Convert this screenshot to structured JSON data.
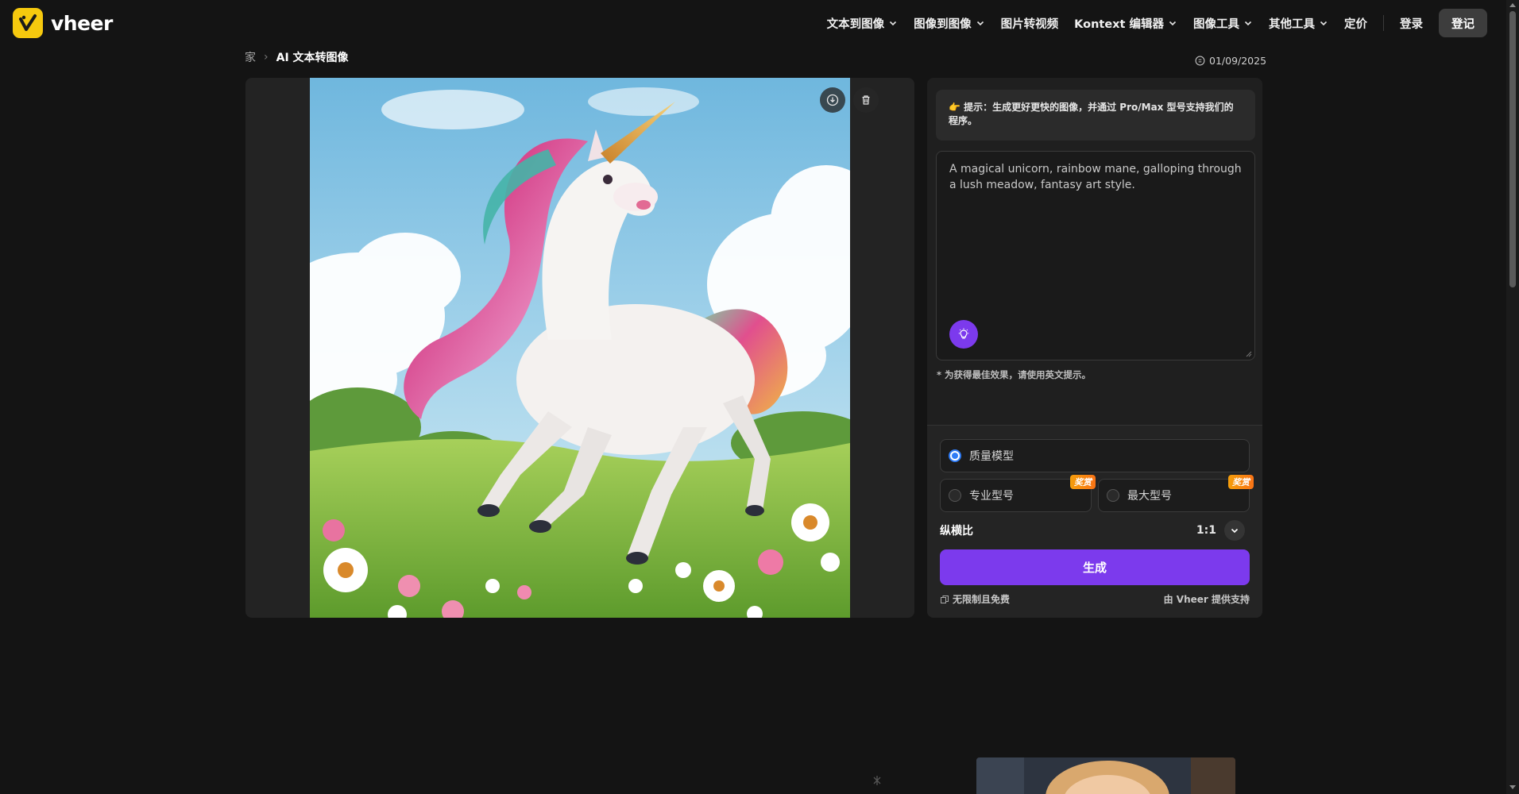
{
  "brand": {
    "name": "vheer"
  },
  "nav": {
    "items": [
      {
        "label": "文本到图像",
        "dropdown": true
      },
      {
        "label": "图像到图像",
        "dropdown": true
      },
      {
        "label": "图片转视频",
        "dropdown": false
      },
      {
        "label": "Kontext 编辑器",
        "dropdown": true
      },
      {
        "label": "图像工具",
        "dropdown": true
      },
      {
        "label": "其他工具",
        "dropdown": true
      },
      {
        "label": "定价",
        "dropdown": false
      }
    ],
    "login_label": "登录",
    "signup_label": "登记"
  },
  "breadcrumb": {
    "home": "家",
    "current": "AI 文本转图像"
  },
  "date": "01/09/2025",
  "generator": {
    "tip": "👉 提示：生成更好更快的图像，并通过 Pro/Max 型号支持我们的程序。",
    "prompt_value": "A magical unicorn, rainbow mane, galloping through a lush meadow, fantasy art style.",
    "english_note": "* 为获得最佳效果，请使用英文提示。",
    "models": {
      "quality": {
        "label": "质量模型",
        "selected": true
      },
      "pro": {
        "label": "专业型号",
        "badge": "奖赏",
        "selected": false
      },
      "max": {
        "label": "最大型号",
        "badge": "奖赏",
        "selected": false
      }
    },
    "aspect_ratio": {
      "label": "纵横比",
      "value": "1:1"
    },
    "generate_label": "生成",
    "free_note": "无限制且免费",
    "powered_by": "由 Vheer 提供支持"
  },
  "colors": {
    "accent": "#7c3aed",
    "brand_yellow": "#f6c90e",
    "radio_blue": "#2f7cf6",
    "background": "#141414",
    "badge_orange": "#f59e0b"
  },
  "icons": [
    "logo-icon",
    "chevron-down-icon",
    "clock-icon",
    "download-icon",
    "trash-icon",
    "lightbulb-icon",
    "copy-icon",
    "sparkle-icon"
  ]
}
